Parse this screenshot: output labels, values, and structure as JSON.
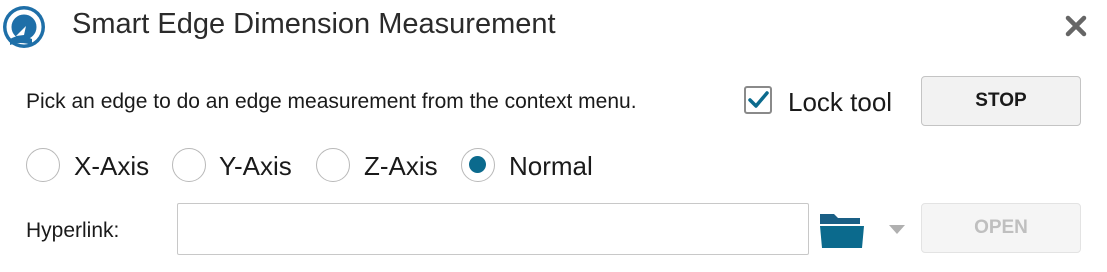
{
  "window": {
    "title": "Smart Edge Dimension Measurement",
    "logo_icon": "app-logo-icon",
    "close_icon": "close-icon"
  },
  "instruction": "Pick an edge to do an edge measurement from the context menu.",
  "lock_tool": {
    "label": "Lock tool",
    "checked": true
  },
  "stop_button": {
    "label": "STOP"
  },
  "axis_options": [
    {
      "label": "X-Axis",
      "selected": false
    },
    {
      "label": "Y-Axis",
      "selected": false
    },
    {
      "label": "Z-Axis",
      "selected": false
    },
    {
      "label": "Normal",
      "selected": true
    }
  ],
  "hyperlink": {
    "label": "Hyperlink:",
    "value": "",
    "folder_icon": "folder-icon",
    "dropdown_icon": "chevron-down-icon",
    "open_button": {
      "label": "OPEN",
      "enabled": false
    }
  },
  "colors": {
    "accent": "#0b6a8d",
    "logo_blue": "#1e6fa8",
    "text": "#1a1a1a",
    "disabled_text": "#bfbfbf"
  }
}
